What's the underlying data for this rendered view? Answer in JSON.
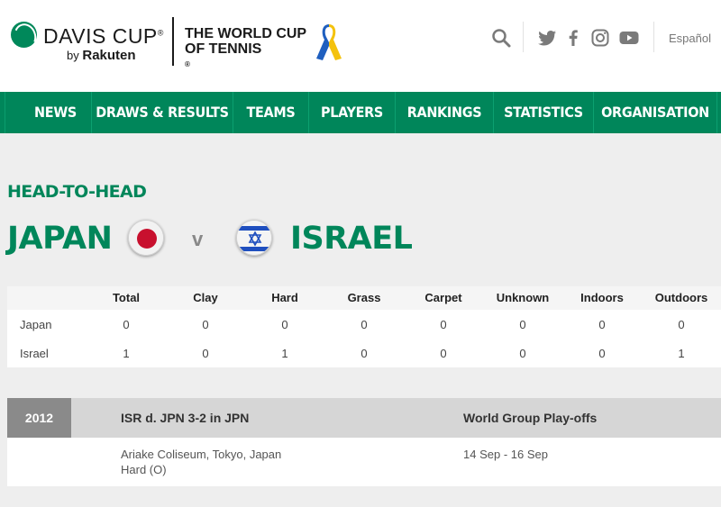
{
  "header": {
    "brand_title": "DAVIS CUP",
    "brand_registered": "®",
    "brand_by": "by",
    "brand_sponsor": "Rakuten",
    "tagline_line1": "THE WORLD CUP",
    "tagline_line2": "OF TENNIS",
    "tagline_registered": "®",
    "ribbon_icon": "ribbon-icon",
    "language": "Español",
    "ribbon_colors": [
      "#1f5fbf",
      "#f4c20d"
    ]
  },
  "nav": {
    "items": [
      {
        "label": "NEWS"
      },
      {
        "label": "DRAWS & RESULTS"
      },
      {
        "label": "TEAMS"
      },
      {
        "label": "PLAYERS"
      },
      {
        "label": "RANKINGS"
      },
      {
        "label": "STATISTICS"
      },
      {
        "label": "ORGANISATION"
      }
    ],
    "color": "#00865a"
  },
  "h2h": {
    "label": "HEAD-TO-HEAD",
    "team1": "JAPAN",
    "team2": "ISRAEL",
    "vs": "v",
    "flag1_icon": "japan-flag-icon",
    "flag2_icon": "israel-flag-icon"
  },
  "stats": {
    "headers": [
      "Total",
      "Clay",
      "Hard",
      "Grass",
      "Carpet",
      "Unknown",
      "Indoors",
      "Outdoors"
    ],
    "rows": [
      {
        "team": "Japan",
        "values": [
          "0",
          "0",
          "0",
          "0",
          "0",
          "0",
          "0",
          "0"
        ]
      },
      {
        "team": "Israel",
        "values": [
          "1",
          "0",
          "1",
          "0",
          "0",
          "0",
          "0",
          "1"
        ]
      }
    ]
  },
  "ties": [
    {
      "year": "2012",
      "result": "ISR d. JPN 3-2 in JPN",
      "round": "World Group Play-offs",
      "venue": "Ariake Coliseum, Tokyo, Japan",
      "surface": "Hard (O)",
      "dates": "14 Sep - 16 Sep"
    }
  ]
}
